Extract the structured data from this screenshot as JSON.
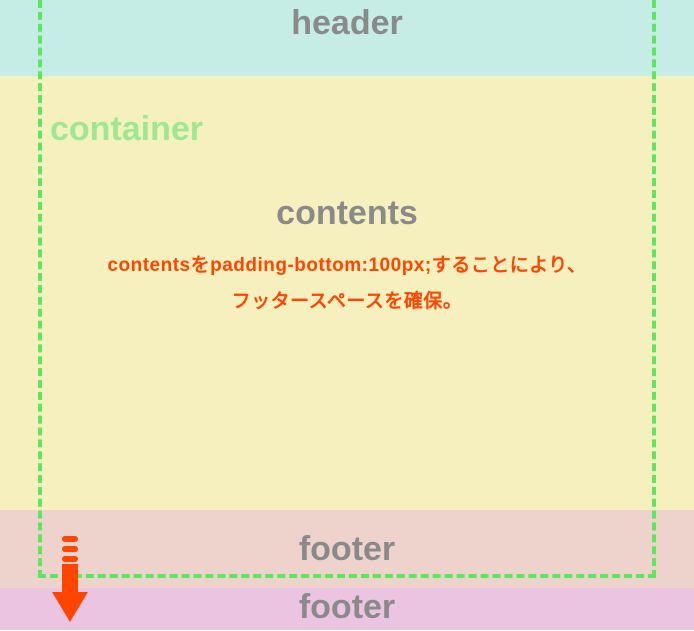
{
  "header": {
    "label": "header"
  },
  "container": {
    "label": "container"
  },
  "contents": {
    "label": "contents",
    "annotation_line1": "contentsをpadding-bottom:100px;することにより、",
    "annotation_line2": "フッタースペースを確保。"
  },
  "footer1": {
    "label": "footer"
  },
  "footer2": {
    "label": "footer"
  },
  "colors": {
    "header_bg": "#c5ede5",
    "container_bg": "#f5f0bd",
    "footer1_bg": "#edd3cc",
    "footer2_bg": "#ebc4e2",
    "label_gray": "#8a8a8a",
    "container_green": "#9de893",
    "annotation_orange": "#ff4500",
    "dashed_green": "#5ce85c",
    "arrow_red": "#ff4500"
  }
}
